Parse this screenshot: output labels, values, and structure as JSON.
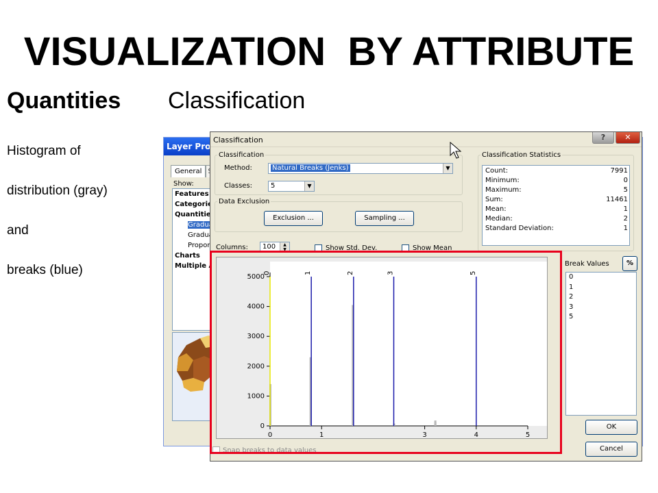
{
  "slide": {
    "title": "VISUALIZATION  BY ATTRIBUTE",
    "subtitle_bold": "Quantities",
    "subtitle_normal": "Classification",
    "notes": [
      "Histogram of",
      "distribution (gray)",
      "and",
      "breaks (blue)"
    ]
  },
  "layer_window": {
    "title": "Layer Prop",
    "tabs": [
      "General",
      "S"
    ],
    "show_label": "Show:",
    "tree": [
      {
        "label": "Features",
        "style": "bold"
      },
      {
        "label": "Categorie",
        "style": "bold"
      },
      {
        "label": "Quantitie",
        "style": "bold"
      },
      {
        "label": "Gradua",
        "style": "selected"
      },
      {
        "label": "Gradua",
        "style": "sub"
      },
      {
        "label": "Propor",
        "style": "sub"
      },
      {
        "label": "Charts",
        "style": "bold"
      },
      {
        "label": "Multiple A",
        "style": "bold"
      }
    ]
  },
  "dialog": {
    "title": "Classification",
    "help_label": "?",
    "close_label": "✕",
    "classification_group": "Classification",
    "method_label": "Method:",
    "method_value": "Natural Breaks (Jenks)",
    "classes_label": "Classes:",
    "classes_value": "5",
    "exclusion_group": "Data Exclusion",
    "exclusion_button": "Exclusion ...",
    "sampling_button": "Sampling ...",
    "columns_label": "Columns:",
    "columns_value": "100",
    "show_std_dev": "Show Std. Dev.",
    "show_mean": "Show Mean",
    "stats_group": "Classification Statistics",
    "stats": [
      {
        "label": "Count:",
        "value": "7991"
      },
      {
        "label": "Minimum:",
        "value": "0"
      },
      {
        "label": "Maximum:",
        "value": "5"
      },
      {
        "label": "Sum:",
        "value": "11461"
      },
      {
        "label": "Mean:",
        "value": "1"
      },
      {
        "label": "Median:",
        "value": "2"
      },
      {
        "label": "Standard Deviation:",
        "value": "1"
      }
    ],
    "break_values_label": "Break Values",
    "percent_button": "%",
    "break_values": [
      "0",
      "1",
      "2",
      "3",
      "5"
    ],
    "ok_button": "OK",
    "cancel_button": "Cancel",
    "snap_label": "Snap breaks to data values"
  },
  "colors": {
    "highlight": "#e8001c",
    "break_line": "#1a1aaa",
    "first_break": "#e8e800",
    "histogram_bar": "#b8b8b8"
  },
  "chart_data": {
    "type": "bar",
    "xlim": [
      0,
      5
    ],
    "ylim": [
      0,
      5000
    ],
    "y_ticks": [
      0,
      1000,
      2000,
      3000,
      4000,
      5000
    ],
    "x_ticks": [
      0,
      1,
      3,
      4,
      5
    ],
    "bins": [
      {
        "x": 0.0,
        "count": 1400
      },
      {
        "x": 0.78,
        "count": 2300
      },
      {
        "x": 1.6,
        "count": 4050
      },
      {
        "x": 2.4,
        "count": 80
      },
      {
        "x": 3.2,
        "count": 120
      },
      {
        "x": 3.2,
        "count": 180
      }
    ],
    "breaks": [
      {
        "label": "0",
        "x": 0.0
      },
      {
        "label": "1",
        "x": 0.8
      },
      {
        "label": "2",
        "x": 1.62
      },
      {
        "label": "3",
        "x": 2.4
      },
      {
        "label": "5",
        "x": 4.0
      }
    ]
  }
}
